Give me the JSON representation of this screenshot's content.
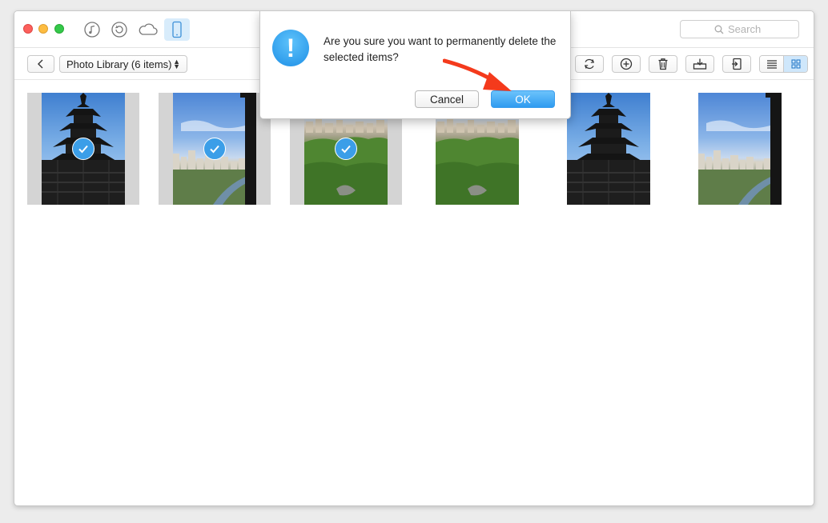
{
  "window": {
    "traffic_lights": [
      "close",
      "minimize",
      "zoom"
    ]
  },
  "titlebar": {
    "icons": [
      {
        "name": "music-note-icon",
        "active": false
      },
      {
        "name": "restore-icon",
        "active": false
      },
      {
        "name": "cloud-icon",
        "active": false
      },
      {
        "name": "phone-icon",
        "active": true
      }
    ],
    "search_placeholder": "Search"
  },
  "toolbar": {
    "library_label": "Photo Library (6 items)",
    "actions": [
      "refresh-icon",
      "add-icon",
      "trash-icon",
      "export-to-computer-icon",
      "send-to-device-icon"
    ],
    "view_modes": [
      {
        "name": "list-view-icon",
        "active": false
      },
      {
        "name": "grid-view-icon",
        "active": true
      }
    ]
  },
  "photos": [
    {
      "scene": "pagoda",
      "selected": true
    },
    {
      "scene": "city",
      "selected": true
    },
    {
      "scene": "forest",
      "selected": true
    },
    {
      "scene": "forest",
      "selected": false
    },
    {
      "scene": "pagoda",
      "selected": false
    },
    {
      "scene": "city",
      "selected": false
    }
  ],
  "dialog": {
    "message": "Are you sure you want to permanently delete the selected items?",
    "cancel_label": "Cancel",
    "ok_label": "OK"
  },
  "colors": {
    "accent": "#3b9ee8",
    "ok_button": "#2f9bf0",
    "annotation_arrow": "#f43a1c"
  }
}
